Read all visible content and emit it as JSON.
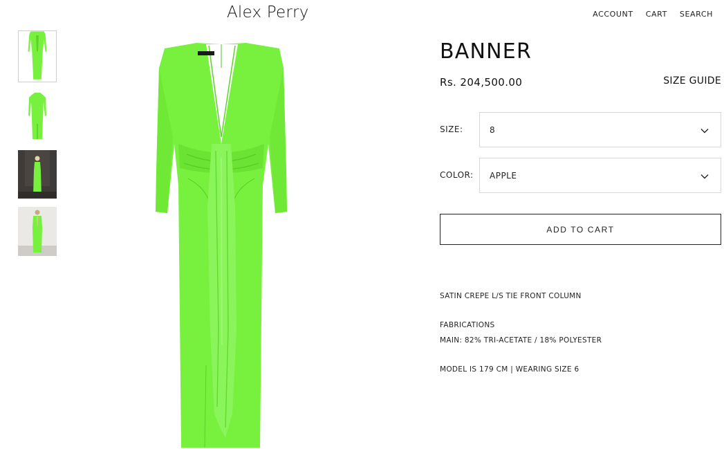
{
  "header": {
    "brand": "Alex Perry",
    "nav": [
      "ACCOUNT",
      "CART",
      "SEARCH"
    ]
  },
  "gallery": {
    "thumbnails": [
      "dress-front-thumbnail",
      "dress-back-thumbnail",
      "model-dark-background-thumbnail",
      "model-grey-background-thumbnail"
    ],
    "dress_color": "#77f13d"
  },
  "product": {
    "title": "BANNER",
    "price": "Rs. 204,500.00",
    "size_guide": "SIZE GUIDE",
    "size": {
      "label": "SIZE:",
      "value": "8"
    },
    "color": {
      "label": "COLOR:",
      "value": "APPLE"
    },
    "add_to_cart": "ADD TO CART",
    "description": {
      "style": "SATIN CREPE L/S TIE FRONT COLUMN",
      "fabrications_heading": "FABRICATIONS",
      "fabrications_main": "MAIN: 82% TRI-ACETATE / 18% POLYESTER",
      "model_info": "MODEL IS 179 CM | WEARING SIZE 6"
    }
  },
  "icons": {
    "select_chevron": "chevron-down-icon"
  }
}
